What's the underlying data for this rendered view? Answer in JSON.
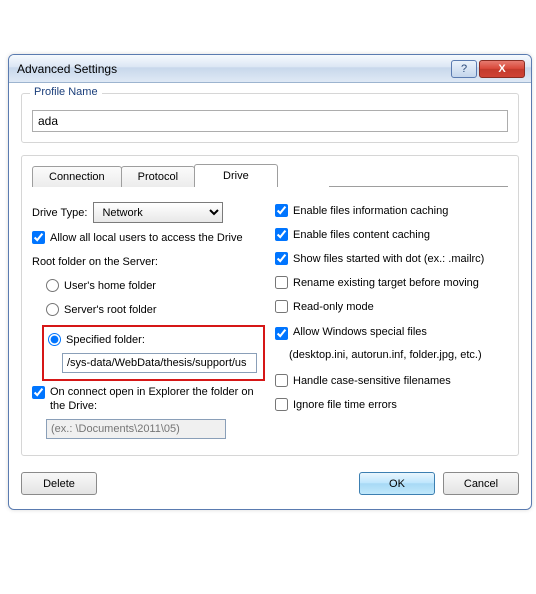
{
  "title": "Advanced Settings",
  "profile": {
    "group_label": "Profile Name",
    "value": "ada"
  },
  "tabs": {
    "connection": "Connection",
    "protocol": "Protocol",
    "drive": "Drive",
    "active": "drive"
  },
  "left": {
    "drive_type_label": "Drive Type:",
    "drive_type_value": "Network",
    "allow_all_users": {
      "label": "Allow all local users to access the Drive",
      "checked": true
    },
    "root_folder_label": "Root folder on the Server:",
    "radios": {
      "user_home": {
        "label": "User's home folder",
        "selected": false
      },
      "server_root": {
        "label": "Server's root folder",
        "selected": false
      },
      "specified": {
        "label": "Specified folder:",
        "selected": true
      }
    },
    "specified_path": "/sys-data/WebData/thesis/support/us",
    "on_connect": {
      "label": "On connect open in Explorer the folder on the Drive:",
      "checked": true
    },
    "on_connect_placeholder": "(ex.: \\Documents\\2011\\05)"
  },
  "right": {
    "enable_info_caching": {
      "label": "Enable files information caching",
      "checked": true
    },
    "enable_content_caching": {
      "label": "Enable files content caching",
      "checked": true
    },
    "show_dot_files": {
      "label": "Show files started with dot (ex.: .mailrc)",
      "checked": true
    },
    "rename_existing": {
      "label": "Rename existing target before moving",
      "checked": false
    },
    "read_only": {
      "label": "Read-only mode",
      "checked": false
    },
    "allow_special": {
      "label": "Allow Windows special files",
      "sublabel": "(desktop.ini, autorun.inf, folder.jpg, etc.)",
      "checked": true
    },
    "case_sensitive": {
      "label": "Handle case-sensitive filenames",
      "checked": false
    },
    "ignore_time": {
      "label": "Ignore file time errors",
      "checked": false
    }
  },
  "buttons": {
    "delete": "Delete",
    "ok": "OK",
    "cancel": "Cancel"
  },
  "titlebar": {
    "help_glyph": "?",
    "close_glyph": "X"
  }
}
